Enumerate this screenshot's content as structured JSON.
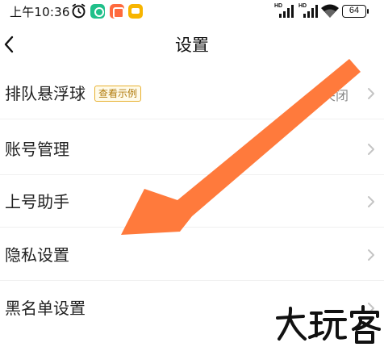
{
  "status_bar": {
    "time": "上午10:36",
    "signal_1": "HD",
    "signal_2": "HD",
    "battery": "64",
    "icons": [
      "alarm-icon",
      "app-icon",
      "app-icon",
      "message-icon",
      "signal-icon",
      "signal-icon",
      "wifi-icon",
      "battery-icon"
    ]
  },
  "header": {
    "title": "设置",
    "back_icon": "chevron-left-icon"
  },
  "items": [
    {
      "label": "排队悬浮球",
      "tag": "查看示例",
      "value": "关闭"
    },
    {
      "label": "账号管理"
    },
    {
      "label": "上号助手"
    },
    {
      "label": "隐私设置"
    },
    {
      "label": "黑名单设置"
    }
  ],
  "overlay": {
    "arrow_color": "#ff7a3c",
    "watermark": "大玩客"
  }
}
